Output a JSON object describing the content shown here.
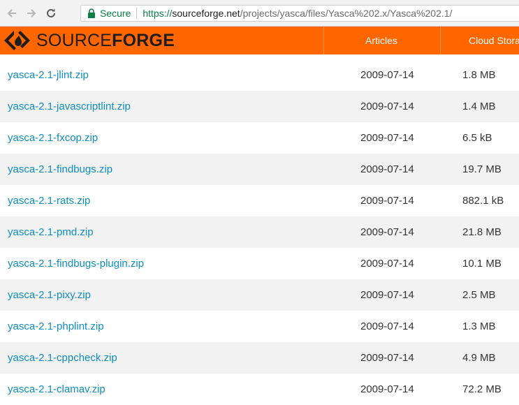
{
  "browser": {
    "secure_label": "Secure",
    "url_scheme": "https://",
    "url_host": "sourceforge.net",
    "url_path": "/projects/yasca/files/Yasca%202.x/Yasca%202.1/"
  },
  "header": {
    "logo_light": "SOURCE",
    "logo_bold": "FORGE",
    "nav": [
      "Articles",
      "Cloud Stora"
    ]
  },
  "files": [
    {
      "name": "yasca-2.1-jlint.zip",
      "date": "2009-07-14",
      "size": "1.8 MB"
    },
    {
      "name": "yasca-2.1-javascriptlint.zip",
      "date": "2009-07-14",
      "size": "1.4 MB"
    },
    {
      "name": "yasca-2.1-fxcop.zip",
      "date": "2009-07-14",
      "size": "6.5 kB"
    },
    {
      "name": "yasca-2.1-findbugs.zip",
      "date": "2009-07-14",
      "size": "19.7 MB"
    },
    {
      "name": "yasca-2.1-rats.zip",
      "date": "2009-07-14",
      "size": "882.1 kB"
    },
    {
      "name": "yasca-2.1-pmd.zip",
      "date": "2009-07-14",
      "size": "21.8 MB"
    },
    {
      "name": "yasca-2.1-findbugs-plugin.zip",
      "date": "2009-07-14",
      "size": "10.1 MB"
    },
    {
      "name": "yasca-2.1-pixy.zip",
      "date": "2009-07-14",
      "size": "2.5 MB"
    },
    {
      "name": "yasca-2.1-phplint.zip",
      "date": "2009-07-14",
      "size": "1.3 MB"
    },
    {
      "name": "yasca-2.1-cppcheck.zip",
      "date": "2009-07-14",
      "size": "4.9 MB"
    },
    {
      "name": "yasca-2.1-clamav.zip",
      "date": "2009-07-14",
      "size": "72.2 MB"
    }
  ],
  "colors": {
    "brand_orange": "#ff6600",
    "link_blue": "#0d8ebd",
    "secure_green": "#0b8043"
  },
  "icons": {
    "back": "arrow-left-icon",
    "forward": "arrow-right-icon",
    "reload": "reload-icon",
    "lock": "lock-icon",
    "logo": "sourceforge-logo-icon"
  }
}
